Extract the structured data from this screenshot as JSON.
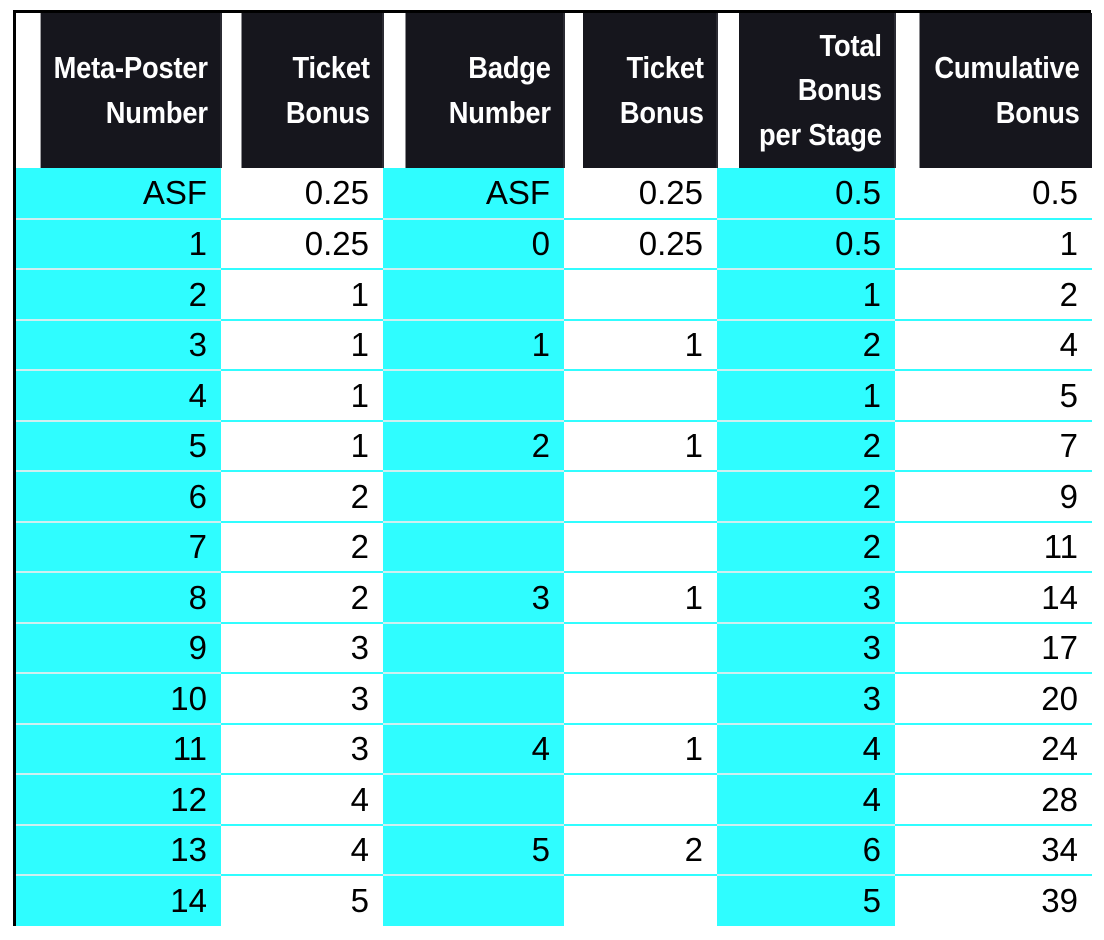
{
  "table": {
    "headers": [
      "Meta-Poster\nNumber",
      "Ticket\nBonus",
      "Badge\nNumber",
      "Ticket\nBonus",
      "Total Bonus\nper Stage",
      "Cumulative\nBonus"
    ],
    "column_fills": [
      "cyan",
      "white",
      "cyan",
      "white",
      "cyan",
      "white"
    ],
    "colors": {
      "header_background": "#16161d",
      "header_text": "#ffffff",
      "cyan_cell": "#2ffdff",
      "white_cell": "#ffffff",
      "cell_text": "#000000",
      "table_border": "#000000",
      "row_divider": "#d9d9d9"
    },
    "rows": [
      [
        "ASF",
        "0.25",
        "ASF",
        "0.25",
        "0.5",
        "0.5"
      ],
      [
        "1",
        "0.25",
        "0",
        "0.25",
        "0.5",
        "1"
      ],
      [
        "2",
        "1",
        "",
        "",
        "1",
        "2"
      ],
      [
        "3",
        "1",
        "1",
        "1",
        "2",
        "4"
      ],
      [
        "4",
        "1",
        "",
        "",
        "1",
        "5"
      ],
      [
        "5",
        "1",
        "2",
        "1",
        "2",
        "7"
      ],
      [
        "6",
        "2",
        "",
        "",
        "2",
        "9"
      ],
      [
        "7",
        "2",
        "",
        "",
        "2",
        "11"
      ],
      [
        "8",
        "2",
        "3",
        "1",
        "3",
        "14"
      ],
      [
        "9",
        "3",
        "",
        "",
        "3",
        "17"
      ],
      [
        "10",
        "3",
        "",
        "",
        "3",
        "20"
      ],
      [
        "11",
        "3",
        "4",
        "1",
        "4",
        "24"
      ],
      [
        "12",
        "4",
        "",
        "",
        "4",
        "28"
      ],
      [
        "13",
        "4",
        "5",
        "2",
        "6",
        "34"
      ],
      [
        "14",
        "5",
        "",
        "",
        "5",
        "39"
      ]
    ]
  }
}
